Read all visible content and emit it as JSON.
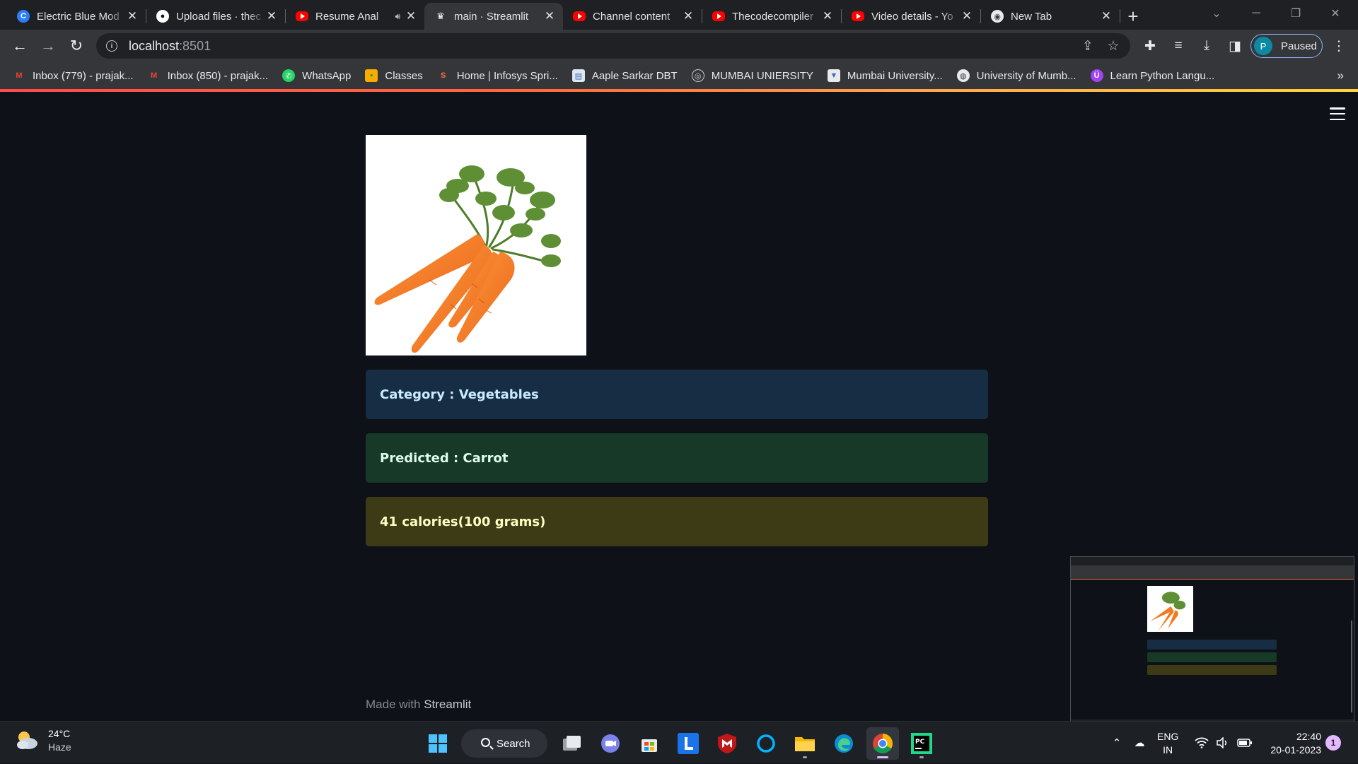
{
  "tabs": [
    {
      "title": "Electric Blue Mod",
      "icon": "canva-icon",
      "active": false
    },
    {
      "title": "Upload files · thec",
      "icon": "github-icon",
      "active": false
    },
    {
      "title": "Resume Anal",
      "icon": "youtube-icon",
      "active": false,
      "audio": true
    },
    {
      "title": "main · Streamlit",
      "icon": "streamlit-icon",
      "active": true
    },
    {
      "title": "Channel content",
      "icon": "youtube-icon",
      "active": false
    },
    {
      "title": "Thecodecompiler",
      "icon": "youtube-icon",
      "active": false
    },
    {
      "title": "Video details - Yo",
      "icon": "youtube-icon",
      "active": false
    },
    {
      "title": "New Tab",
      "icon": "chrome-icon",
      "active": false
    }
  ],
  "toolbar": {
    "url_host": "localhost",
    "url_port": ":8501",
    "profile_initial": "P",
    "profile_status": "Paused"
  },
  "bookmarks": [
    {
      "label": "Inbox (779) - prajak...",
      "icon": "gmail-icon"
    },
    {
      "label": "Inbox (850) - prajak...",
      "icon": "gmail-icon"
    },
    {
      "label": "WhatsApp",
      "icon": "whatsapp-icon"
    },
    {
      "label": "Classes",
      "icon": "classroom-icon"
    },
    {
      "label": "Home | Infosys Spri...",
      "icon": "infosys-icon"
    },
    {
      "label": "Aaple Sarkar DBT",
      "icon": "document-icon"
    },
    {
      "label": "MUMBAI UNIERSITY",
      "icon": "university-seal-icon"
    },
    {
      "label": "Mumbai University...",
      "icon": "university-shield-icon"
    },
    {
      "label": "University of Mumb...",
      "icon": "globe-icon"
    },
    {
      "label": "Learn Python Langu...",
      "icon": "python-icon"
    }
  ],
  "app": {
    "image_alt": "carrot",
    "category_text": "Category : Vegetables",
    "predicted_text": "Predicted : Carrot",
    "calories_text": "41 calories(100 grams)",
    "footer_prefix": "Made with ",
    "footer_brand": "Streamlit"
  },
  "taskbar": {
    "weather_temp": "24°C",
    "weather_desc": "Haze",
    "search_label": "Search",
    "lang_line1": "ENG",
    "lang_line2": "IN",
    "time": "22:40",
    "date": "20-01-2023",
    "notification_count": "1"
  },
  "colors": {
    "app_bg": "#0e1117",
    "info_bg": "#172d43",
    "success_bg": "#173928",
    "warning_bg": "#3d3b15",
    "carrot": "#f47a20"
  }
}
